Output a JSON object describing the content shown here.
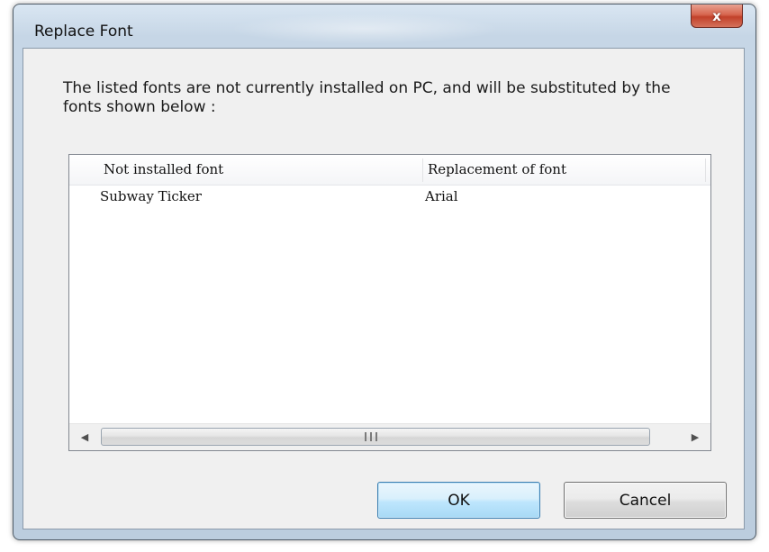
{
  "window": {
    "title": "Replace Font",
    "close_label": "x"
  },
  "dialog": {
    "message": "The listed fonts are not currently installed on PC, and will be substituted by the fonts shown below :"
  },
  "font_list": {
    "columns": [
      "Not installed font",
      "Replacement of font"
    ],
    "rows": [
      {
        "not_installed": "Subway Ticker",
        "replacement": "Arial"
      }
    ],
    "scroll_left_icon": "scroll-left-arrow",
    "scroll_right_icon": "scroll-right-arrow"
  },
  "buttons": {
    "ok_label": "OK",
    "cancel_label": "Cancel"
  },
  "colors": {
    "close_button": "#c2412a",
    "ok_button_border": "#3c7fb1",
    "frame": "#bccdde"
  }
}
